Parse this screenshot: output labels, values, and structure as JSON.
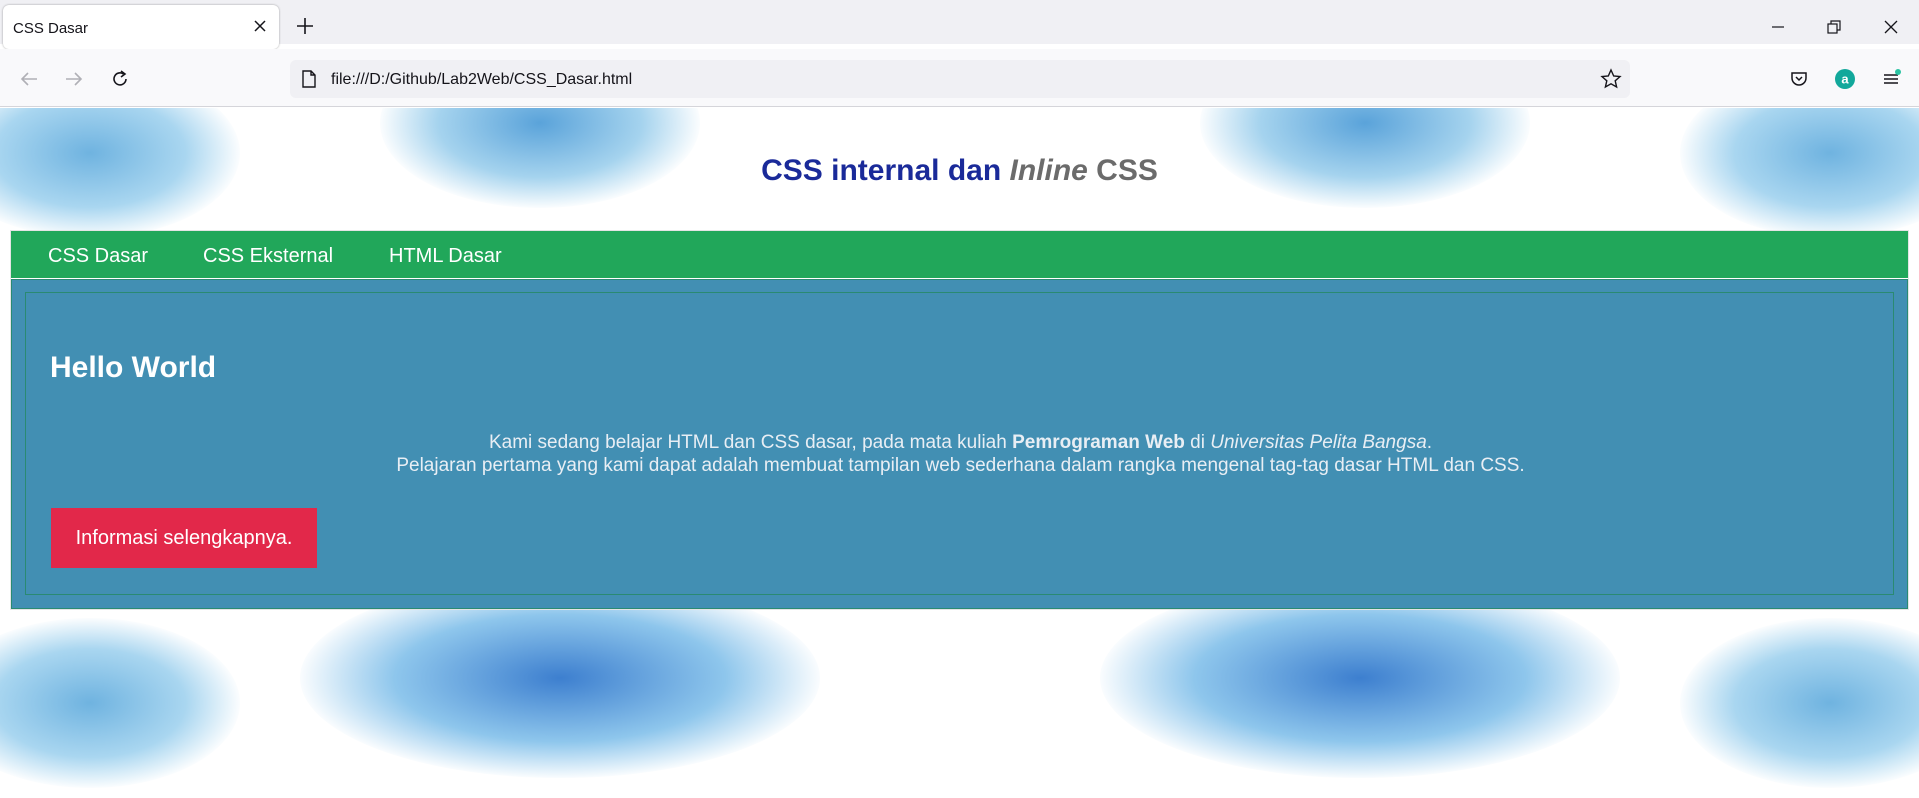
{
  "browser": {
    "tab_title": "CSS Dasar",
    "url": "file:///D:/Github/Lab2Web/CSS_Dasar.html"
  },
  "page": {
    "title_part1": "CSS internal dan ",
    "title_part2": "Inline",
    "title_part3": " CSS",
    "menu": [
      {
        "label": "CSS Dasar"
      },
      {
        "label": "CSS Eksternal"
      },
      {
        "label": "HTML Dasar"
      }
    ],
    "heading": "Hello World",
    "paragraph": {
      "line1_prefix": "Kami sedang belajar HTML dan CSS dasar, pada mata kuliah ",
      "line1_bold": "Pemrograman Web",
      "line1_mid": " di ",
      "line1_italic": "Universitas Pelita Bangsa",
      "line1_suffix": ".",
      "line2": "Pelajaran pertama yang kami dapat adalah membuat tampilan web sederhana dalam rangka mengenal tag-tag dasar HTML dan CSS."
    },
    "button_label": "Informasi selengkapnya."
  },
  "colors": {
    "title_blue": "#1a2a99",
    "menu_green": "#21a75a",
    "content_blue": "#428fb3",
    "button_red": "#e2284a"
  }
}
